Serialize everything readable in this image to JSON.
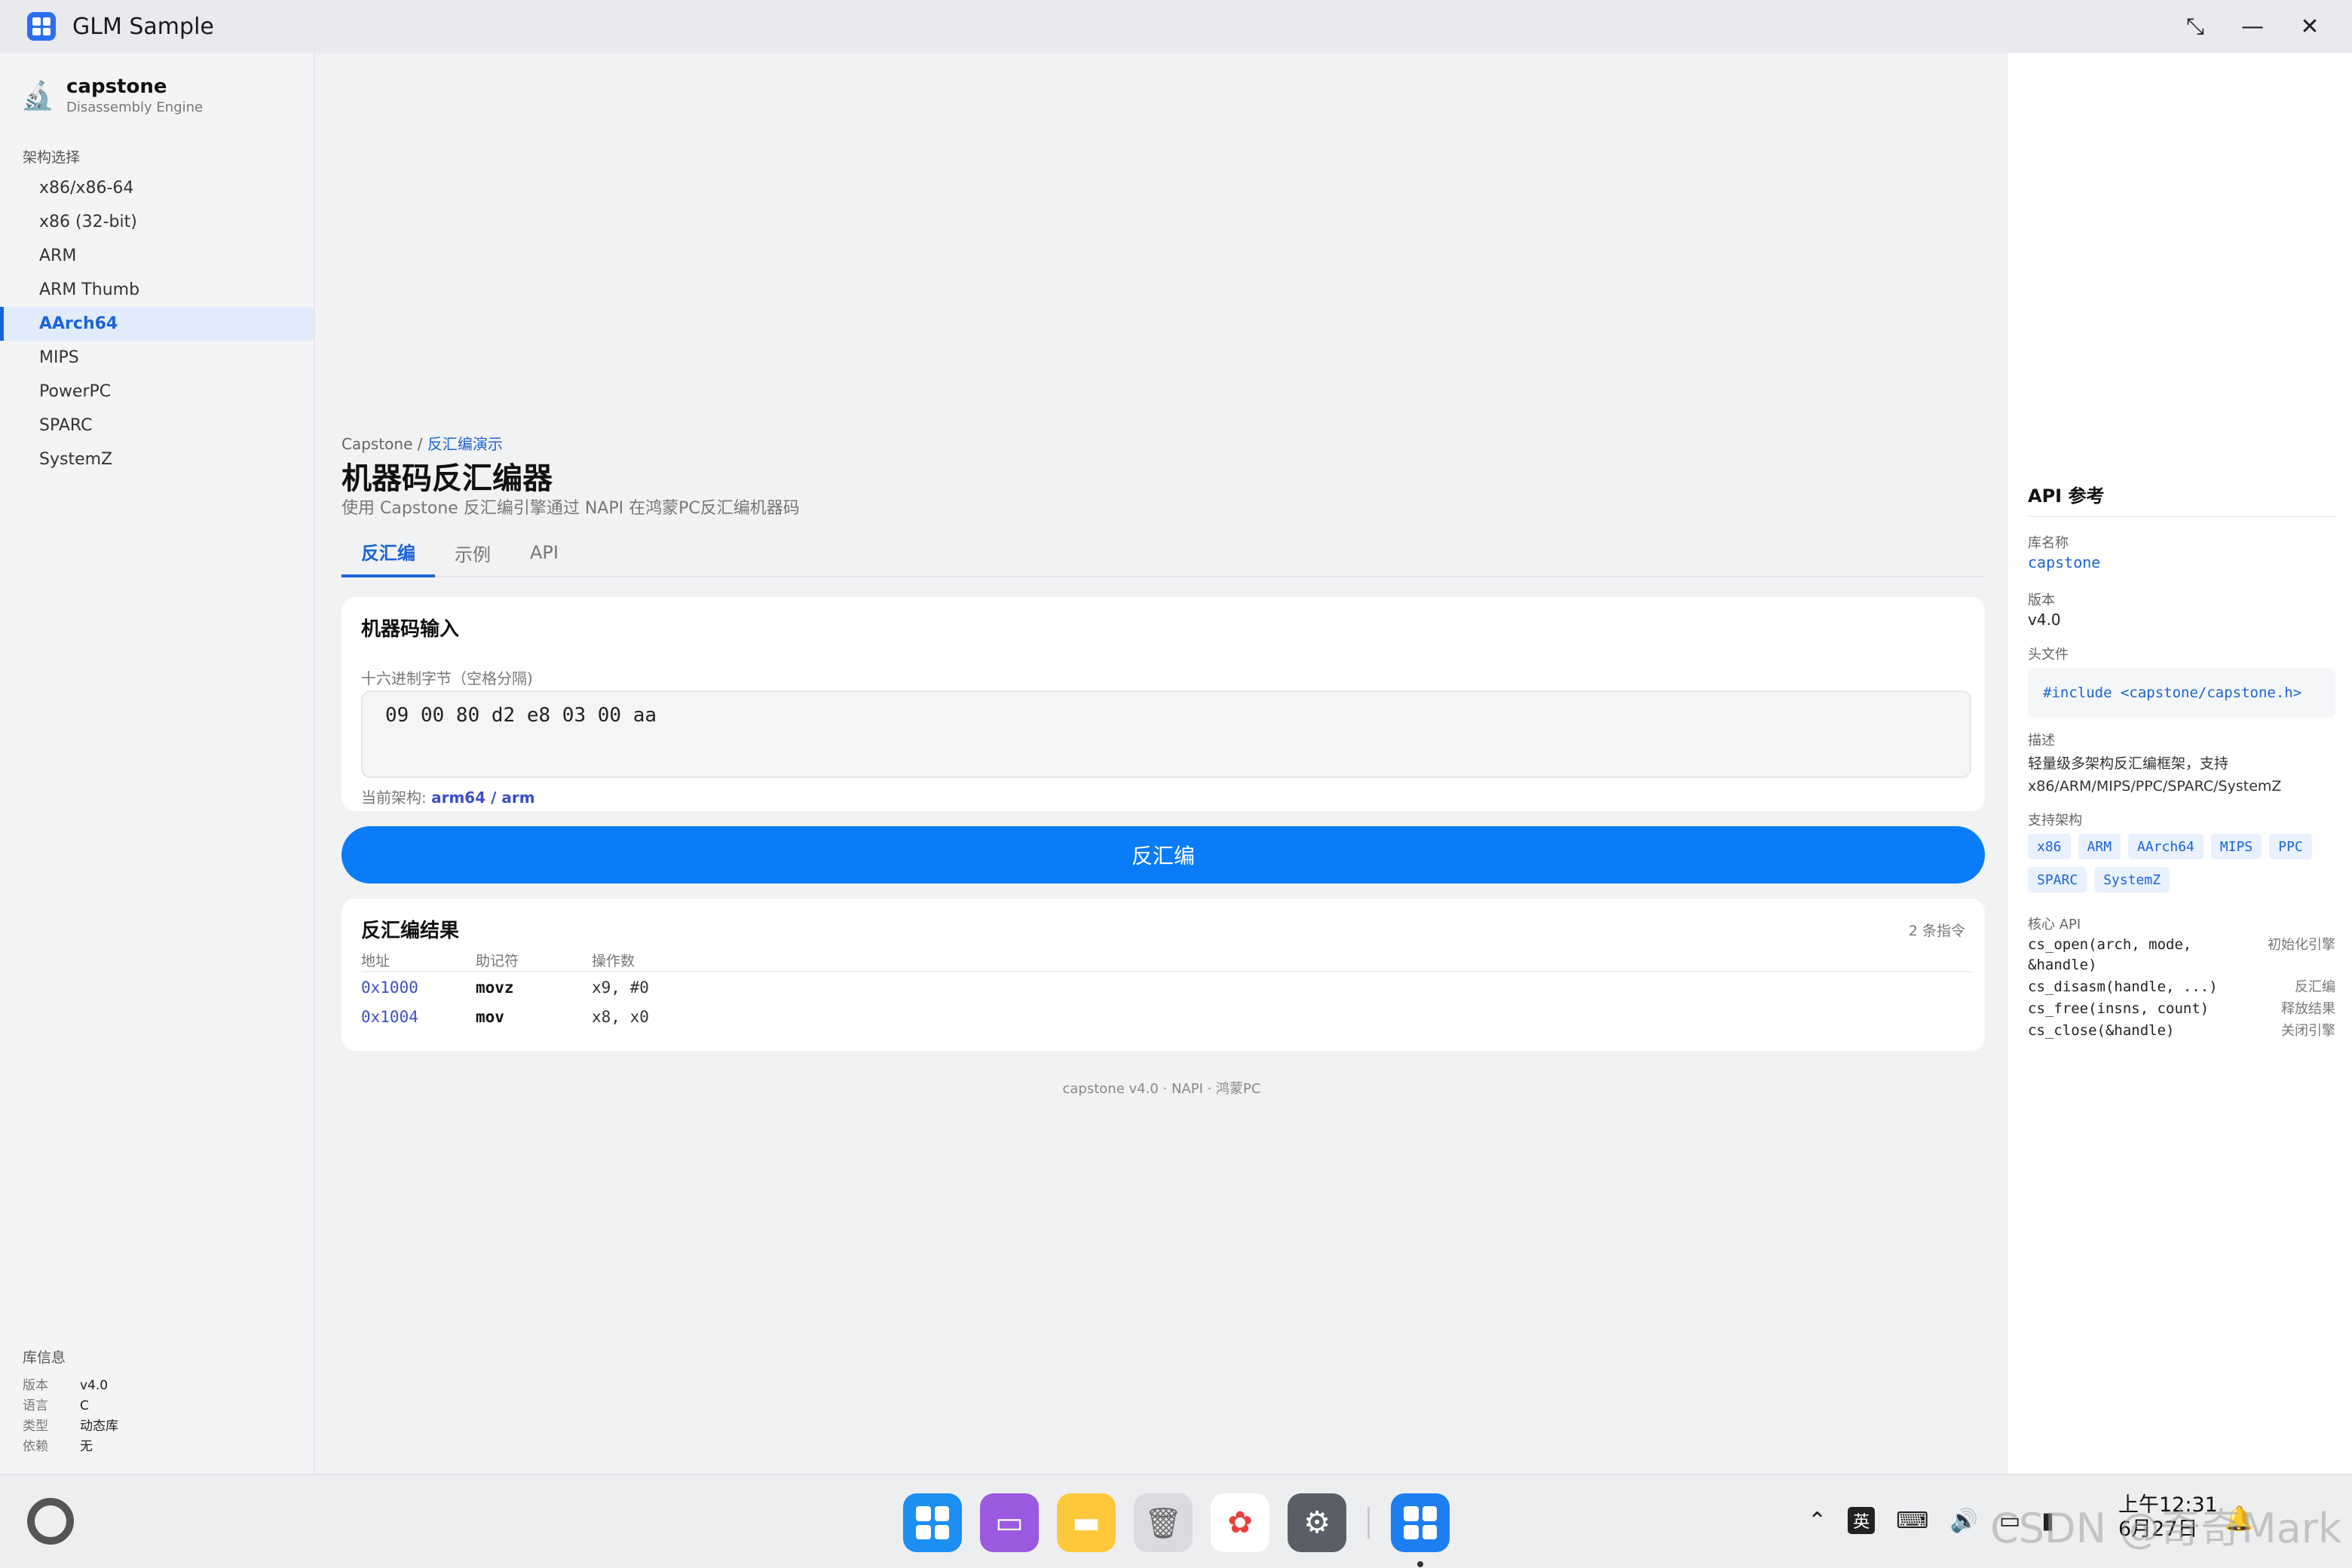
{
  "window": {
    "title": "GLM Sample",
    "controls": [
      "restore-icon",
      "minimize-icon",
      "close-icon"
    ]
  },
  "sidebar": {
    "brand_name": "capstone",
    "brand_sub": "Disassembly Engine",
    "section_label": "架构选择",
    "items": [
      {
        "label": "x86/x86-64"
      },
      {
        "label": "x86 (32-bit)"
      },
      {
        "label": "ARM"
      },
      {
        "label": "ARM Thumb"
      },
      {
        "label": "AArch64",
        "active": true
      },
      {
        "label": "MIPS"
      },
      {
        "label": "PowerPC"
      },
      {
        "label": "SPARC"
      },
      {
        "label": "SystemZ"
      }
    ],
    "libinfo": {
      "title": "库信息",
      "rows": [
        {
          "k": "版本",
          "v": "v4.0"
        },
        {
          "k": "语言",
          "v": "C"
        },
        {
          "k": "类型",
          "v": "动态库"
        },
        {
          "k": "依赖",
          "v": "无"
        }
      ]
    }
  },
  "main": {
    "breadcrumb_root": "Capstone",
    "breadcrumb_sep": " / ",
    "breadcrumb_current": "反汇编演示",
    "title": "机器码反汇编器",
    "subtitle": "使用 Capstone 反汇编引擎通过 NAPI 在鸿蒙PC反汇编机器码",
    "tabs": [
      {
        "label": "反汇编",
        "active": true
      },
      {
        "label": "示例"
      },
      {
        "label": "API"
      }
    ],
    "input_card": {
      "title": "机器码输入",
      "hint": "十六进制字节（空格分隔)",
      "value": "09 00 80 d2 e8 03 00 aa",
      "current_arch_label": "当前架构: ",
      "current_arch_value": "arm64 / arm"
    },
    "run_label": "反汇编",
    "result_card": {
      "title": "反汇编结果",
      "count": "2 条指令",
      "headers": [
        "地址",
        "助记符",
        "操作数"
      ],
      "rows": [
        {
          "addr": "0x1000",
          "mnemonic": "movz",
          "operands": "x9, #0"
        },
        {
          "addr": "0x1004",
          "mnemonic": "mov",
          "operands": "x8, x0"
        }
      ]
    },
    "footer": "capstone v4.0  ·  NAPI  ·  鸿蒙PC"
  },
  "right_panel": {
    "title": "API 参考",
    "lib_label": "库名称",
    "lib_value": "capstone",
    "version_label": "版本",
    "version_value": "v4.0",
    "header_label": "头文件",
    "header_value": "#include <capstone/capstone.h>",
    "desc_label": "描述",
    "desc_value": "轻量级多架构反汇编框架，支持 x86/ARM/MIPS/PPC/SPARC/SystemZ",
    "arch_label": "支持架构",
    "archs": [
      "x86",
      "ARM",
      "AArch64",
      "MIPS",
      "PPC",
      "SPARC",
      "SystemZ"
    ],
    "api_label": "核心 API",
    "apis": [
      {
        "fn": "cs_open(arch, mode, &handle)",
        "desc": "初始化引擎"
      },
      {
        "fn": "cs_disasm(handle, ...)",
        "desc": "反汇编"
      },
      {
        "fn": "cs_free(insns, count)",
        "desc": "释放结果"
      },
      {
        "fn": "cs_close(&handle)",
        "desc": "关闭引擎"
      }
    ]
  },
  "taskbar": {
    "ime": "英",
    "clock_time": "上午12:31",
    "clock_date": "6月27日",
    "watermark": "CSDN @奇奇Mark"
  }
}
